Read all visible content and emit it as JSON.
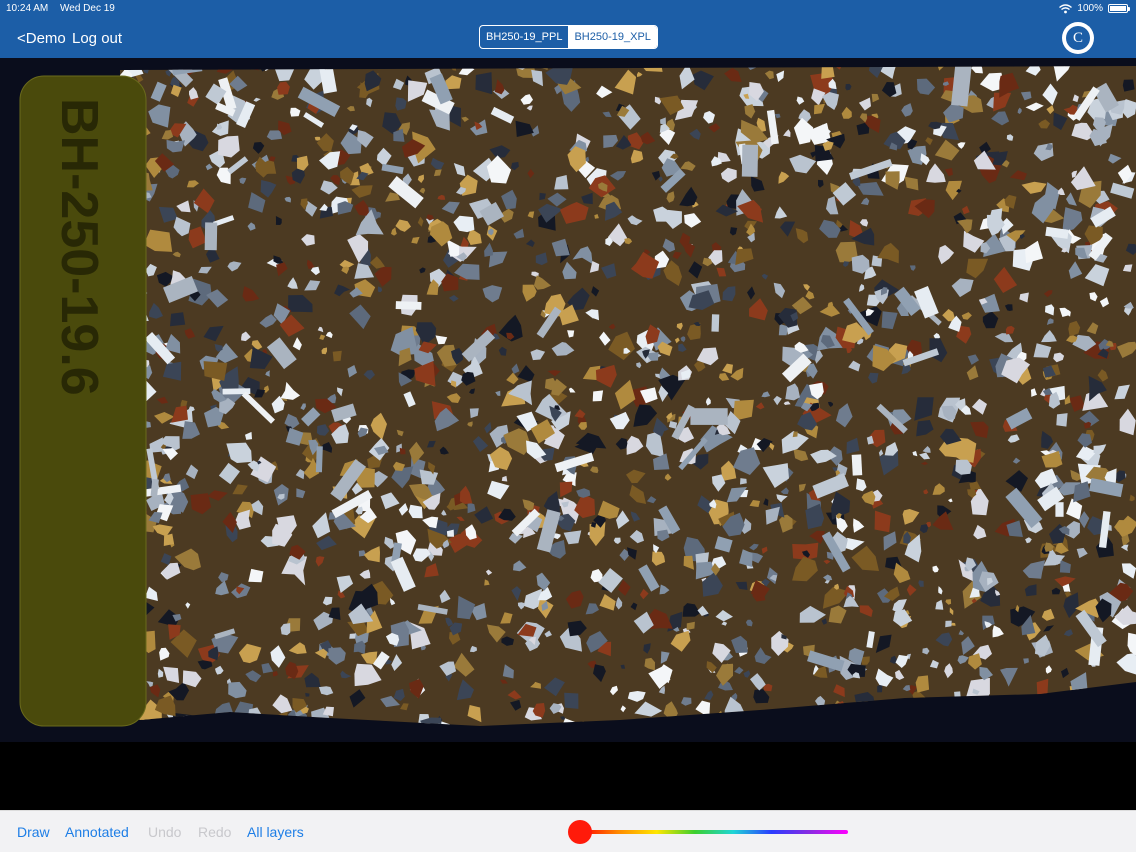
{
  "status_bar": {
    "time": "10:24 AM",
    "date": "Wed Dec 19",
    "battery": "100%",
    "wifi_icon": "wifi-icon"
  },
  "nav": {
    "back_label": "<Demo",
    "logout_label": "Log out",
    "segments": [
      "BH250-19_PPL",
      "BH250-19_XPL"
    ],
    "selected_segment": "BH250-19_XPL",
    "logo_letter": "C"
  },
  "slide": {
    "label_text": "BH-250-19.6"
  },
  "toolbar": {
    "draw_label": "Draw",
    "annotated_label": "Annotated",
    "undo_label": "Undo",
    "redo_label": "Redo",
    "layers_label": "All layers",
    "color_value": "#ff1a0a"
  },
  "colors": {
    "nav_bg": "#1c5ea7",
    "accent": "#1e7ee6",
    "toolbar_bg": "#f2f2f4"
  }
}
